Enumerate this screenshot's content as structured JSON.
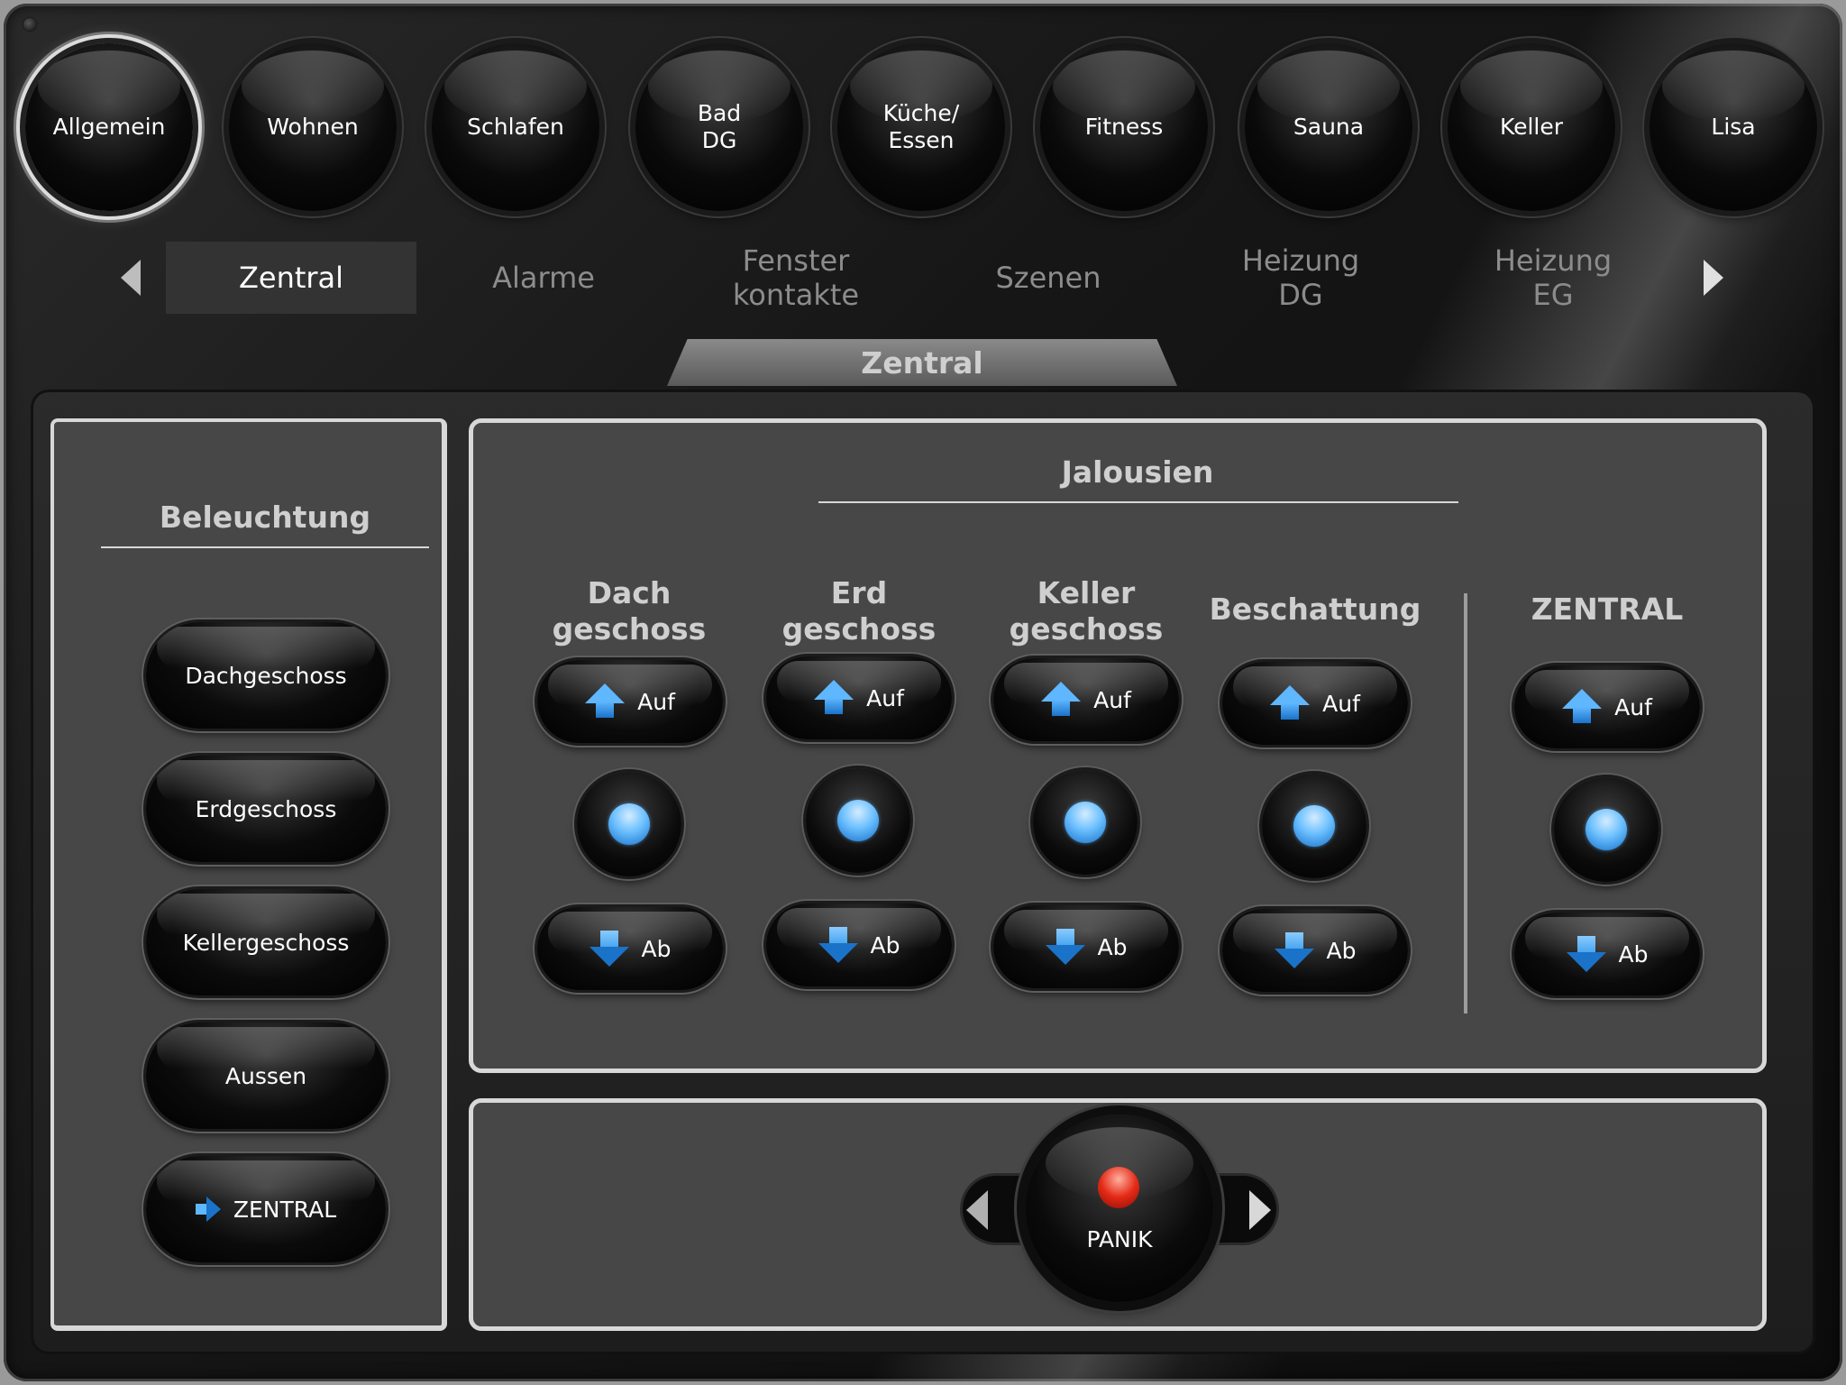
{
  "rooms": [
    {
      "label": "Allgemein",
      "active": true
    },
    {
      "label": "Wohnen"
    },
    {
      "label": "Schlafen"
    },
    {
      "label": "Bad\nDG"
    },
    {
      "label": "Küche/\nEssen"
    },
    {
      "label": "Fitness"
    },
    {
      "label": "Sauna"
    },
    {
      "label": "Keller"
    },
    {
      "label": "Lisa"
    }
  ],
  "tabs": [
    {
      "label": "Zentral",
      "active": true
    },
    {
      "label": "Alarme"
    },
    {
      "label": "Fenster\nkontakte"
    },
    {
      "label": "Szenen"
    },
    {
      "label": "Heizung\nDG"
    },
    {
      "label": "Heizung\nEG"
    }
  ],
  "section_title": "Zentral",
  "lighting": {
    "title": "Beleuchtung",
    "buttons": [
      "Dachgeschoss",
      "Erdgeschoss",
      "Kellergeschoss",
      "Aussen",
      "ZENTRAL"
    ]
  },
  "blinds": {
    "title": "Jalousien",
    "columns": [
      {
        "head": "Dach\ngeschoss"
      },
      {
        "head": "Erd\ngeschoss"
      },
      {
        "head": "Keller\ngeschoss"
      },
      {
        "head": "Beschattung"
      },
      {
        "head": "ZENTRAL"
      }
    ],
    "up_label": "Auf",
    "down_label": "Ab"
  },
  "panic": {
    "label": "PANIK"
  },
  "colors": {
    "accent_blue": "#5fb7ff",
    "panic_red": "#e52a16"
  },
  "icons": {
    "up": "arrow-up-icon",
    "down": "arrow-down-icon",
    "stop": "stop-icon",
    "right": "arrow-right-icon"
  }
}
